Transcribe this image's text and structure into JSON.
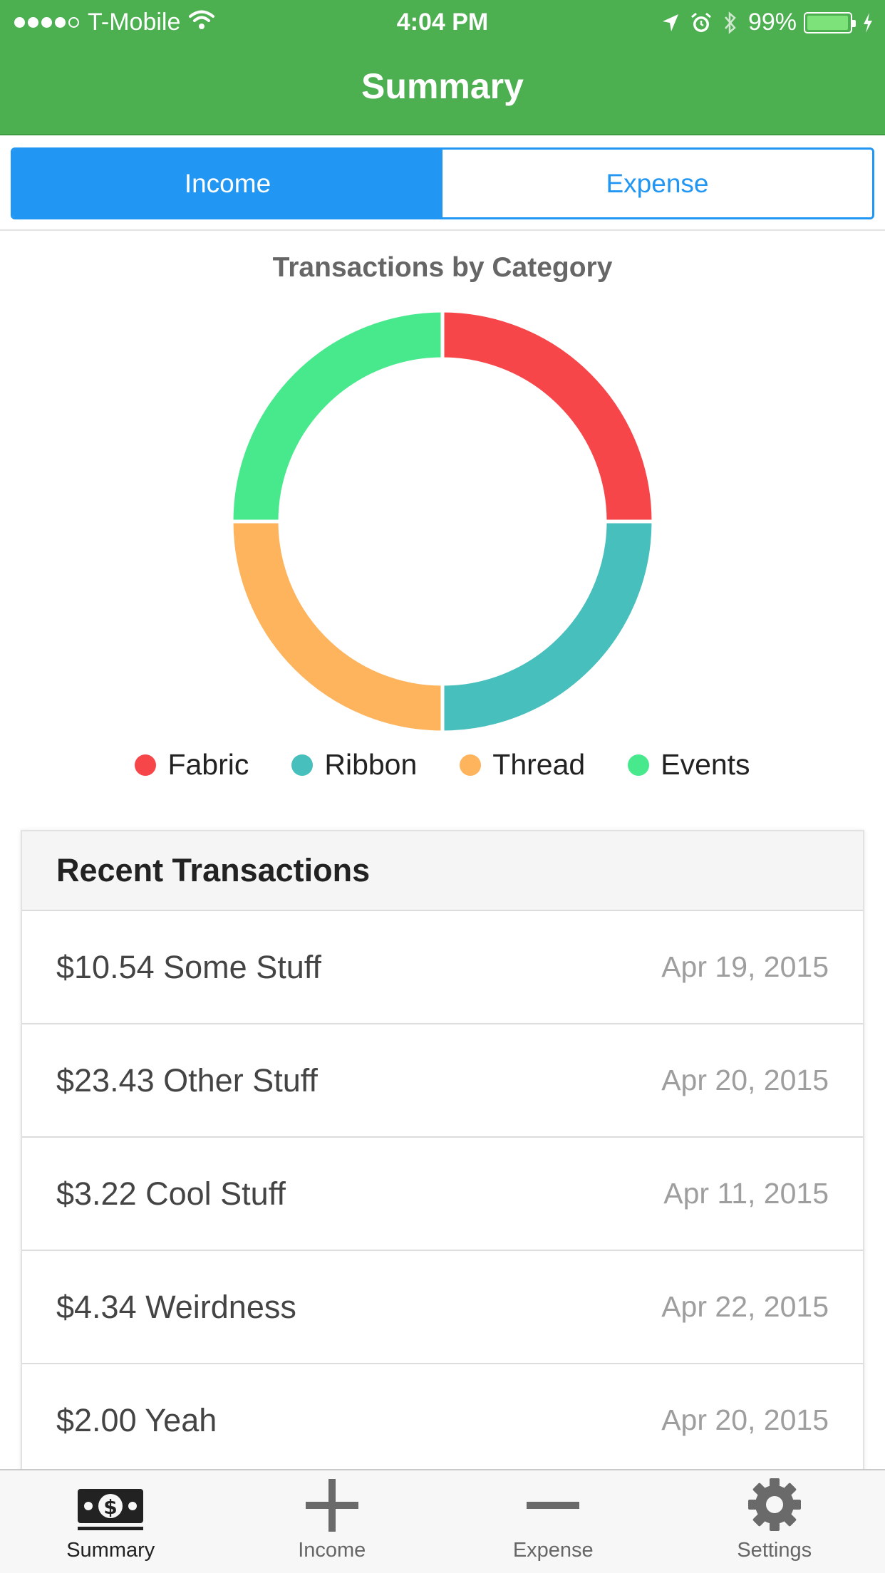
{
  "status_bar": {
    "carrier": "T-Mobile",
    "time": "4:04 PM",
    "battery": "99%",
    "battery_level": 0.99
  },
  "nav": {
    "title": "Summary"
  },
  "segment": {
    "options": [
      "Income",
      "Expense"
    ],
    "selected": "Income",
    "active_color": "#2196f3"
  },
  "chart_data": {
    "type": "pie",
    "style": "doughnut",
    "title": "Transactions by Category",
    "categories": [
      "Fabric",
      "Ribbon",
      "Thread",
      "Events"
    ],
    "values": [
      25,
      25,
      25,
      25
    ],
    "colors": [
      "#f7464a",
      "#46bfbd",
      "#fdb45c",
      "#47e98c"
    ],
    "legend_position": "bottom"
  },
  "recent": {
    "title": "Recent Transactions",
    "rows": [
      {
        "label": "$10.54 Some Stuff",
        "date": "Apr 19, 2015"
      },
      {
        "label": "$23.43 Other Stuff",
        "date": "Apr 20, 2015"
      },
      {
        "label": "$3.22 Cool Stuff",
        "date": "Apr 11, 2015"
      },
      {
        "label": "$4.34 Weirdness",
        "date": "Apr 22, 2015"
      },
      {
        "label": "$2.00 Yeah",
        "date": "Apr 20, 2015"
      }
    ]
  },
  "tabs": [
    {
      "label": "Summary",
      "icon": "money-icon",
      "active": true
    },
    {
      "label": "Income",
      "icon": "plus-icon",
      "active": false
    },
    {
      "label": "Expense",
      "icon": "minus-icon",
      "active": false
    },
    {
      "label": "Settings",
      "icon": "gear-icon",
      "active": false
    }
  ],
  "colors": {
    "nav_bar": "#4caf50",
    "accent": "#2196f3"
  }
}
